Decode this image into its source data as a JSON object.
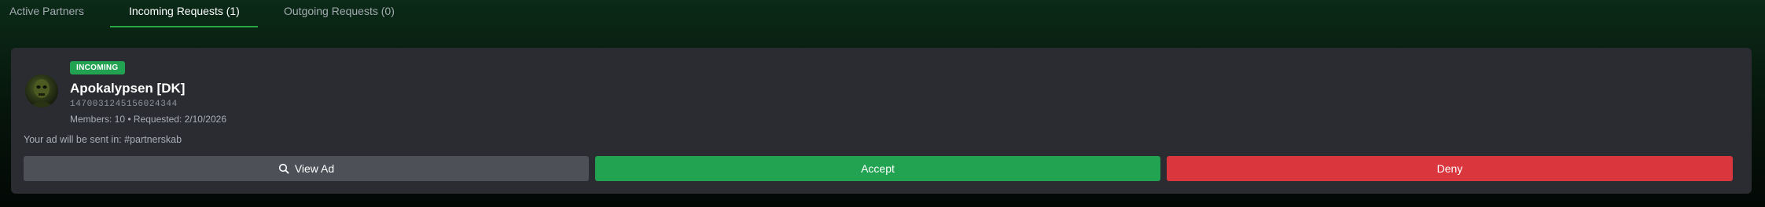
{
  "tabs": [
    {
      "label": "Active Partners",
      "active": false
    },
    {
      "label": "Incoming Requests (1)",
      "active": true
    },
    {
      "label": "Outgoing Requests (0)",
      "active": false
    }
  ],
  "request": {
    "badge": "INCOMING",
    "server_name": "Apokalypsen [DK]",
    "server_id": "1470031245156024344",
    "meta": "Members: 10 • Requested: 2/10/2026",
    "ad_note": "Your ad will be sent in: #partnerskab",
    "actions": {
      "view_ad": "View Ad",
      "accept": "Accept",
      "deny": "Deny"
    }
  },
  "colors": {
    "accent": "#28a745",
    "badge_bg": "#22a352",
    "accept": "#22a352",
    "deny": "#d9363e",
    "view": "#4e5058",
    "card_bg": "#2b2c31"
  },
  "icons": {
    "view_ad": "search-icon",
    "avatar": "server-avatar"
  }
}
